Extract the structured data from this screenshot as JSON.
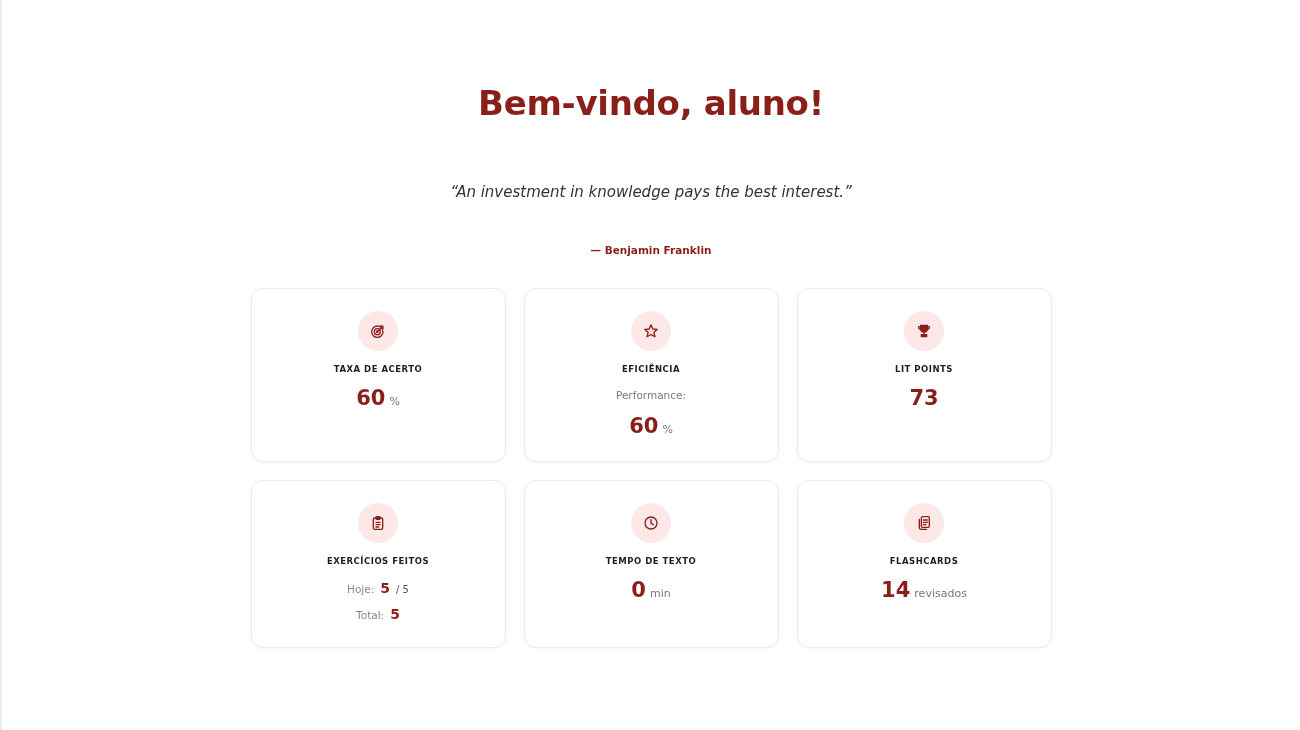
{
  "heading": "Bem-vindo, aluno!",
  "quote": {
    "text": "“An investment in knowledge pays the best interest.”",
    "author": "— Benjamin Franklin"
  },
  "cards": [
    {
      "kind": "stat",
      "label": "TAXA DE ACERTO",
      "value": "60",
      "unit": "%"
    },
    {
      "kind": "stat",
      "label": "EFICIÊNCIA",
      "caption": "Performance:",
      "value": "60",
      "unit": "%"
    },
    {
      "kind": "stat",
      "label": "LIT POINTS",
      "value": "73"
    },
    {
      "kind": "breakdown",
      "label": "EXERCÍCIOS FEITOS",
      "rows": [
        {
          "label": "Hoje:",
          "value": "5",
          "unit": "/ 5"
        },
        {
          "label": "Total:",
          "value": "5"
        }
      ]
    },
    {
      "kind": "stat",
      "label": "TEMPO DE TEXTO",
      "value": "0",
      "unit": "min"
    },
    {
      "kind": "stat",
      "label": "FLASHCARDS",
      "value": "14",
      "unit": "revisados"
    }
  ]
}
